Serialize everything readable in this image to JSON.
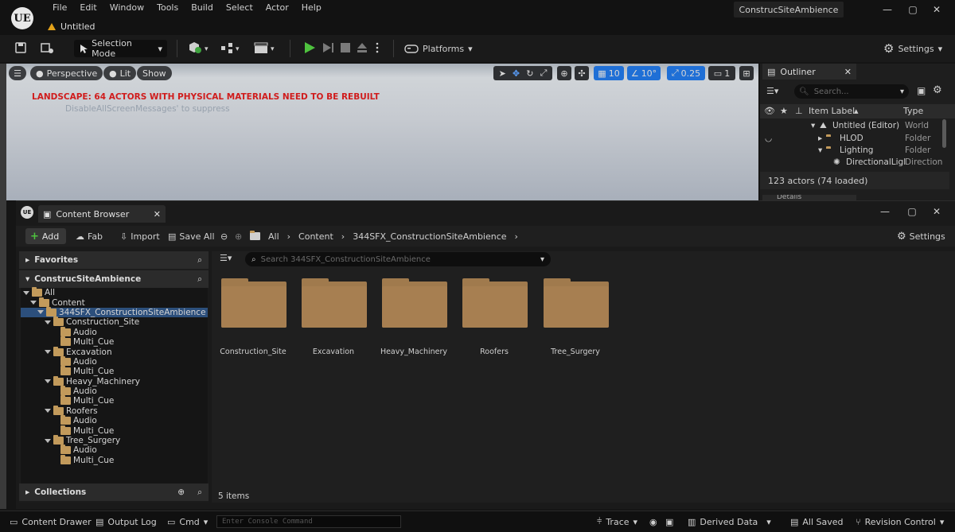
{
  "app": {
    "logo": "UE",
    "menu": [
      "File",
      "Edit",
      "Window",
      "Tools",
      "Build",
      "Select",
      "Actor",
      "Help"
    ],
    "level_tab": "Untitled",
    "project": "ConstrucSiteAmbience",
    "window_controls": [
      "—",
      "▢",
      "✕"
    ]
  },
  "toolbar": {
    "selection_mode": "Selection Mode",
    "platforms": "Platforms",
    "settings": "Settings"
  },
  "viewport": {
    "perspective": "Perspective",
    "lit": "Lit",
    "show": "Show",
    "warning": "LANDSCAPE: 64 ACTORS WITH PHYSICAL MATERIALS NEED TO BE REBUILT",
    "suppress": "DisableAllScreenMessages' to suppress",
    "grid_snap": "10",
    "rotation_snap": "10°",
    "scale_snap": "0.25",
    "camera_speed": "1"
  },
  "outliner": {
    "tab": "Outliner",
    "search_placeholder": "Search...",
    "col_label": "Item Label",
    "col_type": "Type",
    "rows": [
      {
        "label": "Untitled (Editor)",
        "type": "World"
      },
      {
        "label": "HLOD",
        "type": "Folder"
      },
      {
        "label": "Lighting",
        "type": "Folder"
      },
      {
        "label": "DirectionalLigl",
        "type": "Direction"
      }
    ],
    "count": "123 actors (74 loaded)",
    "details_tab": "Details"
  },
  "content_browser": {
    "tab": "Content Browser",
    "add": "Add",
    "fab": "Fab",
    "import": "Import",
    "save_all": "Save All",
    "breadcrumb": [
      "All",
      "Content",
      "344SFX_ConstructionSiteAmbience"
    ],
    "settings": "Settings",
    "favorites": "Favorites",
    "project_panel": "ConstrucSiteAmbience",
    "collections": "Collections",
    "search_placeholder": "Search 344SFX_ConstructionSiteAmbience",
    "tree": [
      {
        "label": "All",
        "depth": 0
      },
      {
        "label": "Content",
        "depth": 1
      },
      {
        "label": "344SFX_ConstructionSiteAmbience",
        "depth": 2,
        "selected": true
      },
      {
        "label": "Construction_Site",
        "depth": 3
      },
      {
        "label": "Audio",
        "depth": 4
      },
      {
        "label": "Multi_Cue",
        "depth": 4
      },
      {
        "label": "Excavation",
        "depth": 3
      },
      {
        "label": "Audio",
        "depth": 4
      },
      {
        "label": "Multi_Cue",
        "depth": 4
      },
      {
        "label": "Heavy_Machinery",
        "depth": 3
      },
      {
        "label": "Audio",
        "depth": 4
      },
      {
        "label": "Multi_Cue",
        "depth": 4
      },
      {
        "label": "Roofers",
        "depth": 3
      },
      {
        "label": "Audio",
        "depth": 4
      },
      {
        "label": "Multi_Cue",
        "depth": 4
      },
      {
        "label": "Tree_Surgery",
        "depth": 3
      },
      {
        "label": "Audio",
        "depth": 4
      },
      {
        "label": "Multi_Cue",
        "depth": 4
      }
    ],
    "folders": [
      "Construction_Site",
      "Excavation",
      "Heavy_Machinery",
      "Roofers",
      "Tree_Surgery"
    ],
    "item_count": "5 items"
  },
  "statusbar": {
    "content_drawer": "Content Drawer",
    "output_log": "Output Log",
    "cmd": "Cmd",
    "console_placeholder": "Enter Console Command",
    "trace": "Trace",
    "derived_data": "Derived Data",
    "all_saved": "All Saved",
    "revision_control": "Revision Control"
  }
}
